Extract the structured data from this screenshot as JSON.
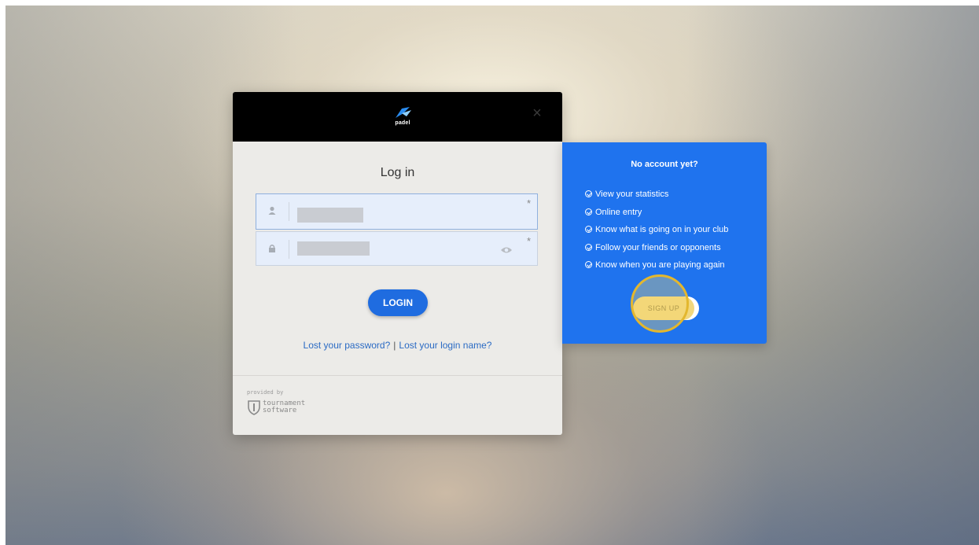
{
  "modal": {
    "logo_text": "padel",
    "close_label": "×",
    "title": "Log in",
    "username": {
      "value": "",
      "required": "*"
    },
    "password": {
      "value": "",
      "required": "*"
    },
    "login_label": "LOGIN",
    "lost_password": "Lost your password?",
    "separator": "|",
    "lost_login": "Lost your login name?",
    "provided_by": "provided by",
    "vendor_line1": "tournament",
    "vendor_line2": "software"
  },
  "signup": {
    "title": "No account yet?",
    "benefits": [
      "View your statistics",
      "Online entry",
      "Know what is going on in your club",
      "Follow your friends or opponents",
      "Know when you are playing again"
    ],
    "button_label": "SIGN UP"
  },
  "colors": {
    "header_bg": "#000000",
    "primary": "#1f6ce0",
    "panel_blue": "#1f73ee",
    "highlight": "#e3b72e"
  }
}
